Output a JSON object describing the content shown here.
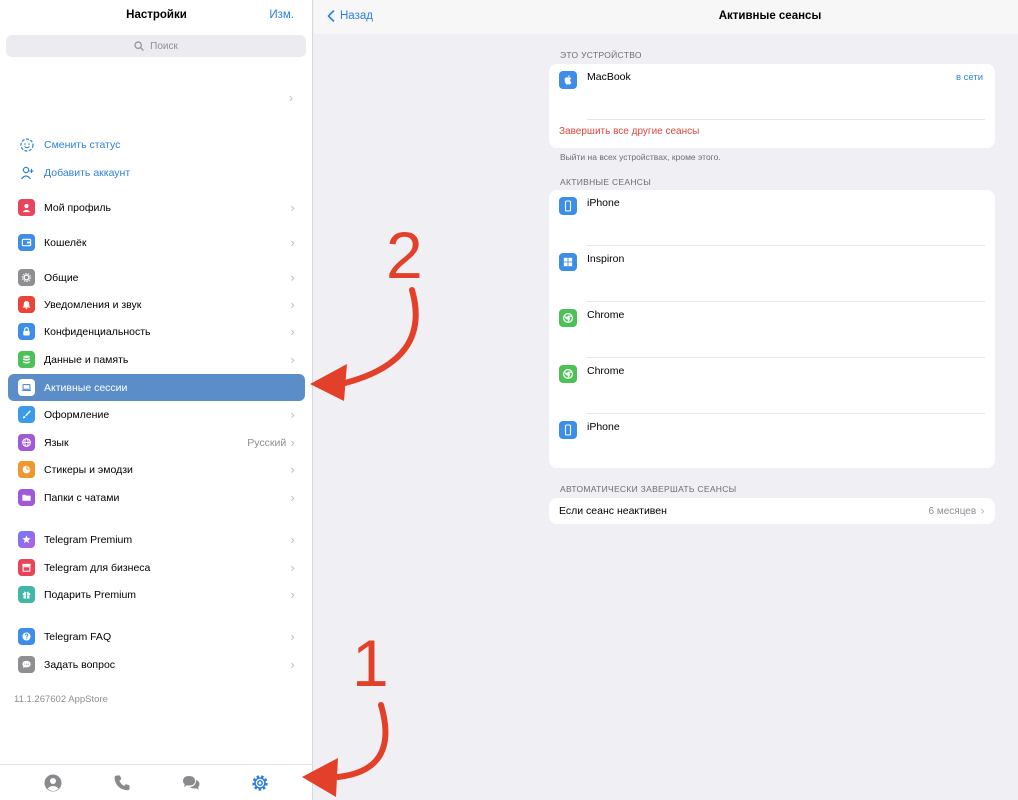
{
  "left": {
    "title": "Настройки",
    "edit_label": "Изм.",
    "search_placeholder": "Поиск",
    "links": [
      {
        "label": "Сменить статус",
        "icon": "smile-icon"
      },
      {
        "label": "Добавить аккаунт",
        "icon": "add-person-icon"
      }
    ],
    "items": [
      {
        "label": "Мой профиль",
        "icon": "person-icon",
        "color": "#e8455a",
        "value": ""
      },
      {
        "label": "Кошелёк",
        "icon": "wallet-icon",
        "color": "#3c8ee8",
        "value": ""
      },
      {
        "label": "Общие",
        "icon": "gear-icon",
        "color": "#8e8e93",
        "value": ""
      },
      {
        "label": "Уведомления и звук",
        "icon": "bell-icon",
        "color": "#eb4538",
        "value": ""
      },
      {
        "label": "Конфиденциальность",
        "icon": "lock-icon",
        "color": "#3c8ee8",
        "value": ""
      },
      {
        "label": "Данные и память",
        "icon": "database-icon",
        "color": "#4cc158",
        "value": ""
      },
      {
        "label": "Активные сессии",
        "icon": "laptop-icon",
        "color": "#5b8dc9",
        "value": ""
      },
      {
        "label": "Оформление",
        "icon": "brush-icon",
        "color": "#3c9be8",
        "value": ""
      },
      {
        "label": "Язык",
        "icon": "globe-icon",
        "color": "#a05ad8",
        "value": "Русский"
      },
      {
        "label": "Стикеры и эмодзи",
        "icon": "sticker-icon",
        "color": "#f0962a",
        "value": ""
      },
      {
        "label": "Папки с чатами",
        "icon": "folder-icon",
        "color": "#a05ad8",
        "value": ""
      },
      {
        "label": "Telegram Premium",
        "icon": "star-icon",
        "color": "#8b6cf0",
        "value": ""
      },
      {
        "label": "Telegram для бизнеса",
        "icon": "shop-icon",
        "color": "#e8455a",
        "value": ""
      },
      {
        "label": "Подарить Premium",
        "icon": "gift-icon",
        "color": "#3fb8a8",
        "value": ""
      },
      {
        "label": "Telegram FAQ",
        "icon": "question-icon",
        "color": "#3c8ee8",
        "value": ""
      },
      {
        "label": "Задать вопрос",
        "icon": "chat-bubble-icon",
        "color": "#8e8e93",
        "value": ""
      }
    ],
    "version": "11.1.267602 AppStore",
    "tabs": [
      "contacts-icon",
      "calls-icon",
      "chats-icon",
      "settings-icon"
    ]
  },
  "right": {
    "back_label": "Назад",
    "title": "Активные сеансы",
    "this_device_caption": "ЭТО УСТРОЙСТВО",
    "this_device": {
      "name": "MacBook",
      "status": "в сети",
      "icon": "apple-icon",
      "color": "#3c8ee8"
    },
    "terminate_label": "Завершить все другие сеансы",
    "terminate_note": "Выйти на всех устройствах, кроме этого.",
    "active_caption": "АКТИВНЫЕ СЕАНСЫ",
    "sessions": [
      {
        "name": "iPhone",
        "icon": "iphone-icon",
        "color": "#3c8ee8"
      },
      {
        "name": "Inspiron",
        "icon": "windows-icon",
        "color": "#3c8ee8"
      },
      {
        "name": "Chrome",
        "icon": "chrome-icon",
        "color": "#4cc158"
      },
      {
        "name": "Chrome",
        "icon": "chrome-icon",
        "color": "#4cc158"
      },
      {
        "name": "iPhone",
        "icon": "iphone-icon",
        "color": "#3c8ee8"
      }
    ],
    "auto_caption": "АВТОМАТИЧЕСКИ ЗАВЕРШАТЬ СЕАНСЫ",
    "auto_label": "Если сеанс неактивен",
    "auto_value": "6 месяцев"
  },
  "annotations": {
    "step1": "1",
    "step2": "2",
    "color": "#e3402a"
  }
}
